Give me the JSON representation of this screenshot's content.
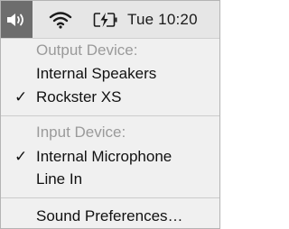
{
  "menubar": {
    "volume_icon": "speaker-volume-icon",
    "wifi_icon": "wifi-icon",
    "battery_icon": "battery-charging-icon",
    "clock": "Tue 10:20"
  },
  "menu": {
    "output_header": "Output Device:",
    "output_items": [
      {
        "label": "Internal Speakers",
        "checked": false,
        "check": ""
      },
      {
        "label": "Rockster XS",
        "checked": true,
        "check": "✓"
      }
    ],
    "input_header": "Input Device:",
    "input_items": [
      {
        "label": "Internal Microphone",
        "checked": true,
        "check": "✓"
      },
      {
        "label": "Line In",
        "checked": false,
        "check": ""
      }
    ],
    "sound_preferences": "Sound Preferences…"
  }
}
